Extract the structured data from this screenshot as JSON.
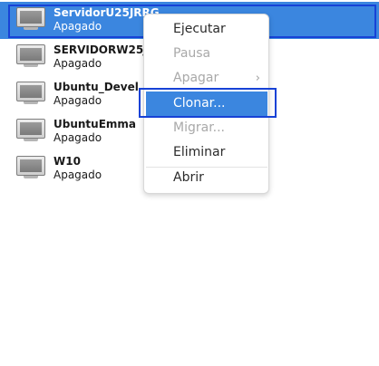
{
  "vms": [
    {
      "name": "ServidorU25JRRG",
      "status": "Apagado"
    },
    {
      "name": "SERVIDORW25JF",
      "status": "Apagado"
    },
    {
      "name": "Ubuntu_Devel",
      "status": "Apagado"
    },
    {
      "name": "UbuntuEmma",
      "status": "Apagado"
    },
    {
      "name": "W10",
      "status": "Apagado"
    }
  ],
  "selected_vm": "ServidorU25JRRG",
  "context_menu": {
    "items": [
      {
        "label": "Ejecutar",
        "enabled": true
      },
      {
        "label": "Pausa",
        "enabled": false
      },
      {
        "label": "Apagar",
        "enabled": false,
        "submenu": true
      },
      {
        "label": "Clonar...",
        "enabled": true,
        "highlighted": true
      },
      {
        "label": "Migrar...",
        "enabled": false
      },
      {
        "label": "Eliminar",
        "enabled": true
      },
      {
        "label": "Abrir",
        "enabled": true
      }
    ]
  },
  "colors": {
    "selection": "#3b86df",
    "outline": "#1742d6"
  },
  "icons": {
    "vm": "monitor-icon",
    "submenu": "chevron-right-icon"
  }
}
